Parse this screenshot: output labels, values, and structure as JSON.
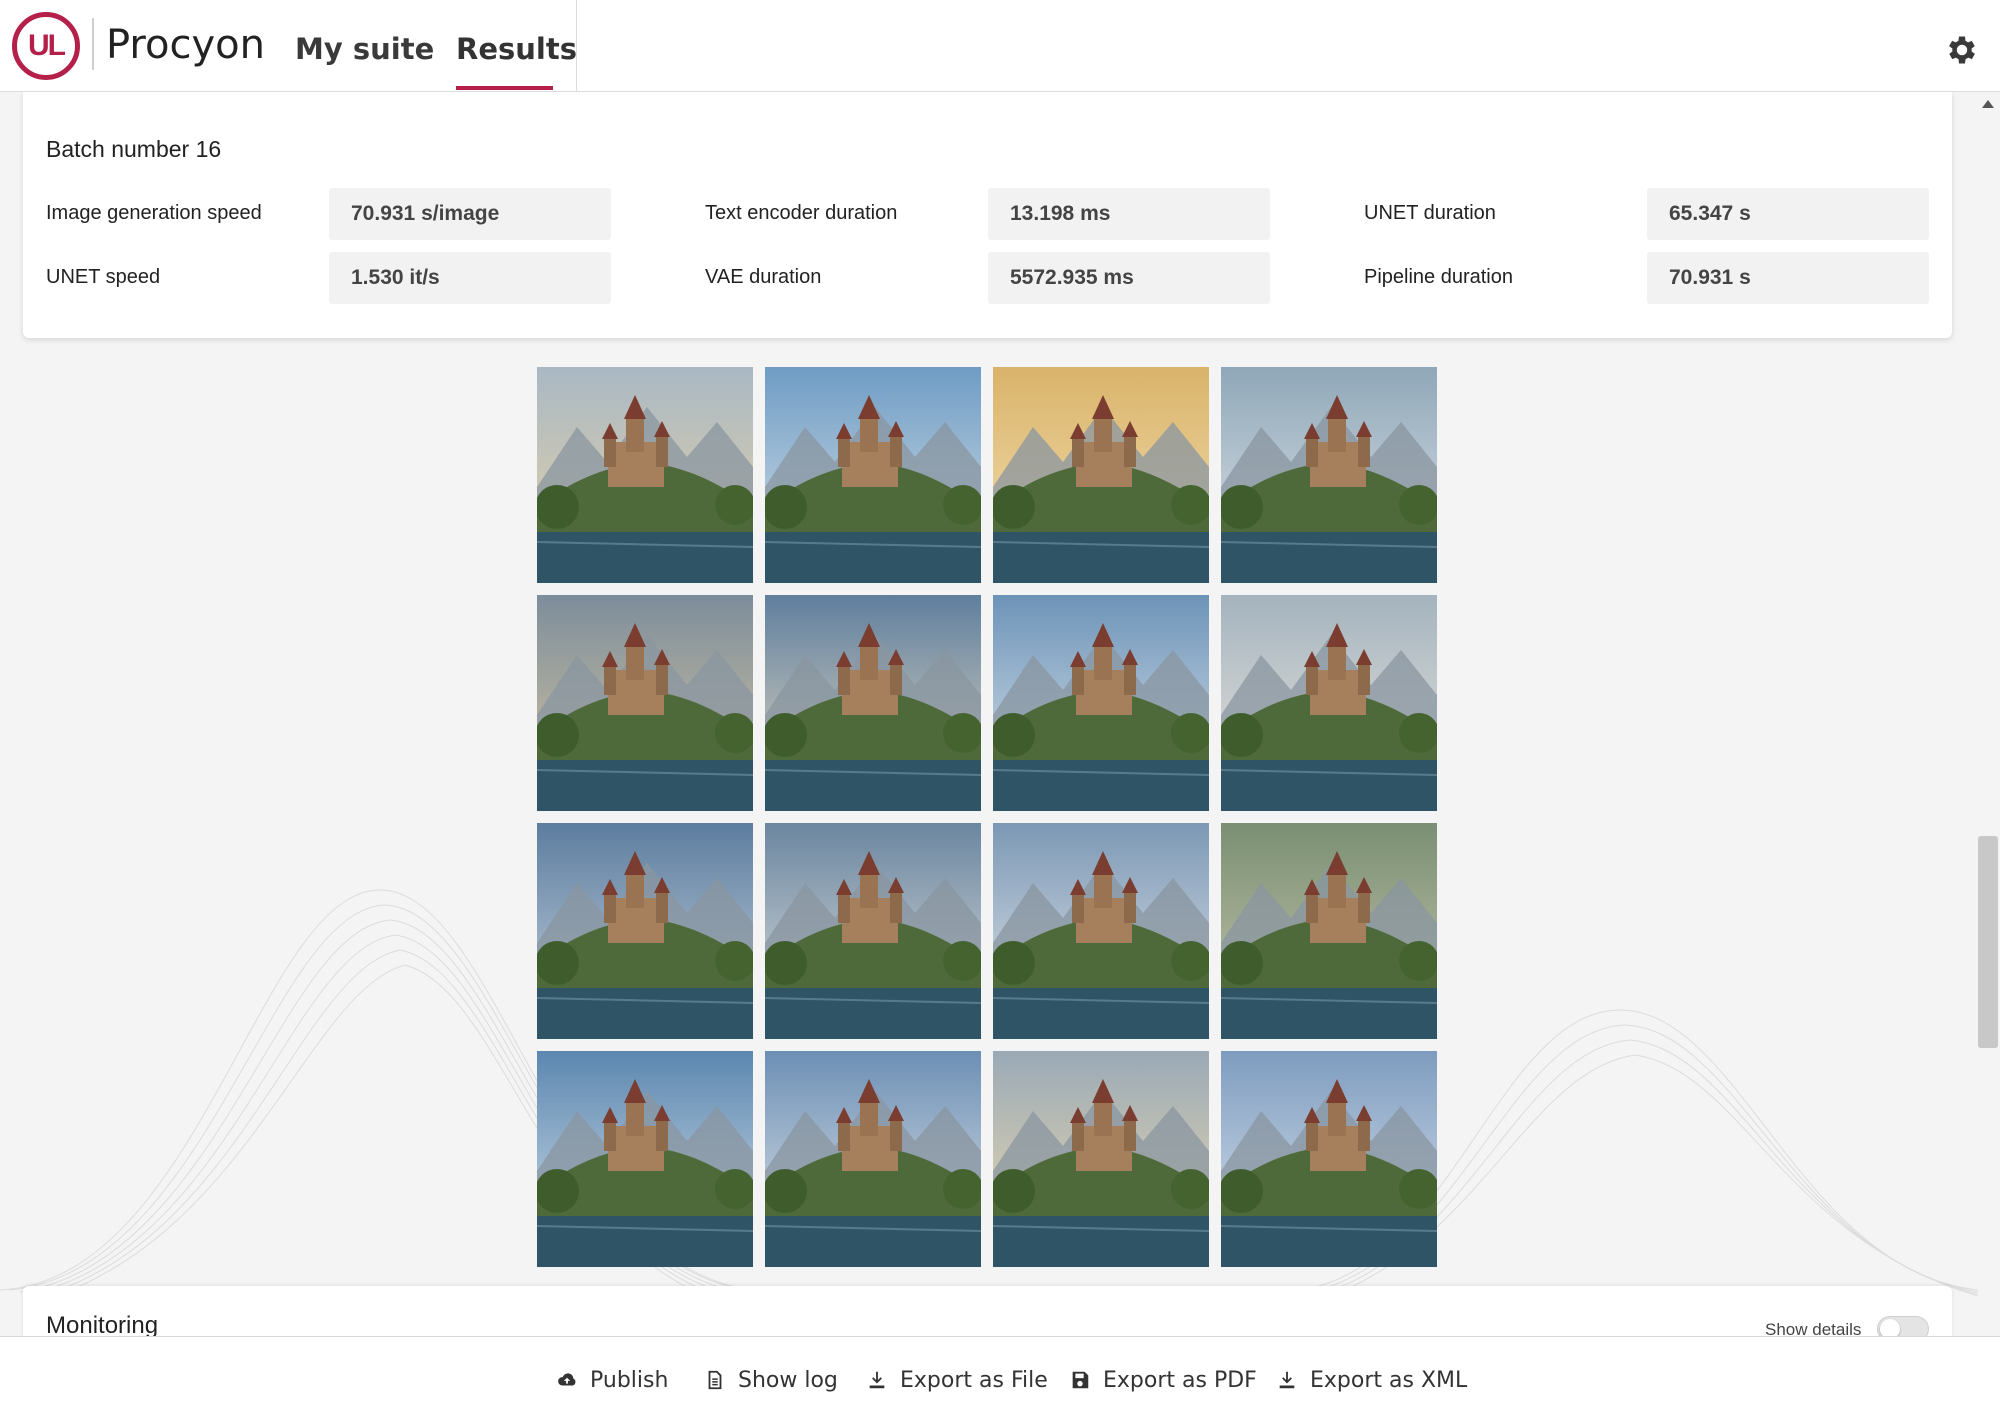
{
  "header": {
    "logo_text": "UL",
    "brand": "Procyon",
    "tabs": [
      {
        "label": "My suite",
        "active": false
      },
      {
        "label": "Results",
        "active": true
      }
    ],
    "settings_icon": "gear-icon",
    "accent_color": "#b5204a"
  },
  "batch": {
    "title": "Batch number 16",
    "metrics": [
      {
        "label": "Image generation speed",
        "value": "70.931 s/image"
      },
      {
        "label": "Text encoder duration",
        "value": "13.198 ms"
      },
      {
        "label": "UNET duration",
        "value": "65.347 s"
      },
      {
        "label": "UNET speed",
        "value": "1.530 it/s"
      },
      {
        "label": "VAE duration",
        "value": "5572.935 ms"
      },
      {
        "label": "Pipeline duration",
        "value": "70.931 s"
      }
    ]
  },
  "images": {
    "count": 16,
    "subject": "castle-image"
  },
  "monitoring": {
    "title": "Monitoring",
    "show_details_label": "Show details",
    "show_details_on": false
  },
  "footer": {
    "buttons": [
      {
        "label": "Publish",
        "icon": "cloud-upload-icon"
      },
      {
        "label": "Show log",
        "icon": "document-icon"
      },
      {
        "label": "Export as File",
        "icon": "download-icon"
      },
      {
        "label": "Export as PDF",
        "icon": "save-icon"
      },
      {
        "label": "Export as XML",
        "icon": "download-icon"
      }
    ]
  }
}
